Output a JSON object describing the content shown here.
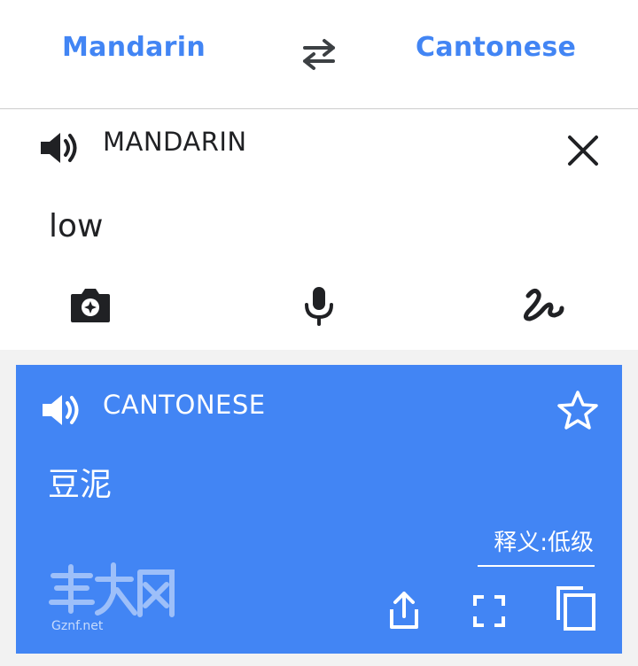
{
  "lang_bar": {
    "source_language": "Mandarin",
    "target_language": "Cantonese",
    "swap_icon": "swap-arrows-icon"
  },
  "input_card": {
    "language_label": "MANDARIN",
    "text": "low",
    "speaker_icon": "speaker-icon",
    "close_icon": "close-icon",
    "tools": [
      "camera-icon",
      "microphone-icon",
      "handwriting-icon"
    ]
  },
  "output_card": {
    "language_label": "CANTONESE",
    "text": "豆泥",
    "gloss": "释义:低级",
    "speaker_icon": "speaker-icon",
    "star_icon": "star-outline-icon",
    "actions": [
      "share-icon",
      "fullscreen-icon",
      "copy-icon"
    ],
    "watermark_text": "Gznf.net"
  },
  "colors": {
    "accent": "#4285f4",
    "background": "#f2f2f2",
    "text_primary": "#202124"
  }
}
